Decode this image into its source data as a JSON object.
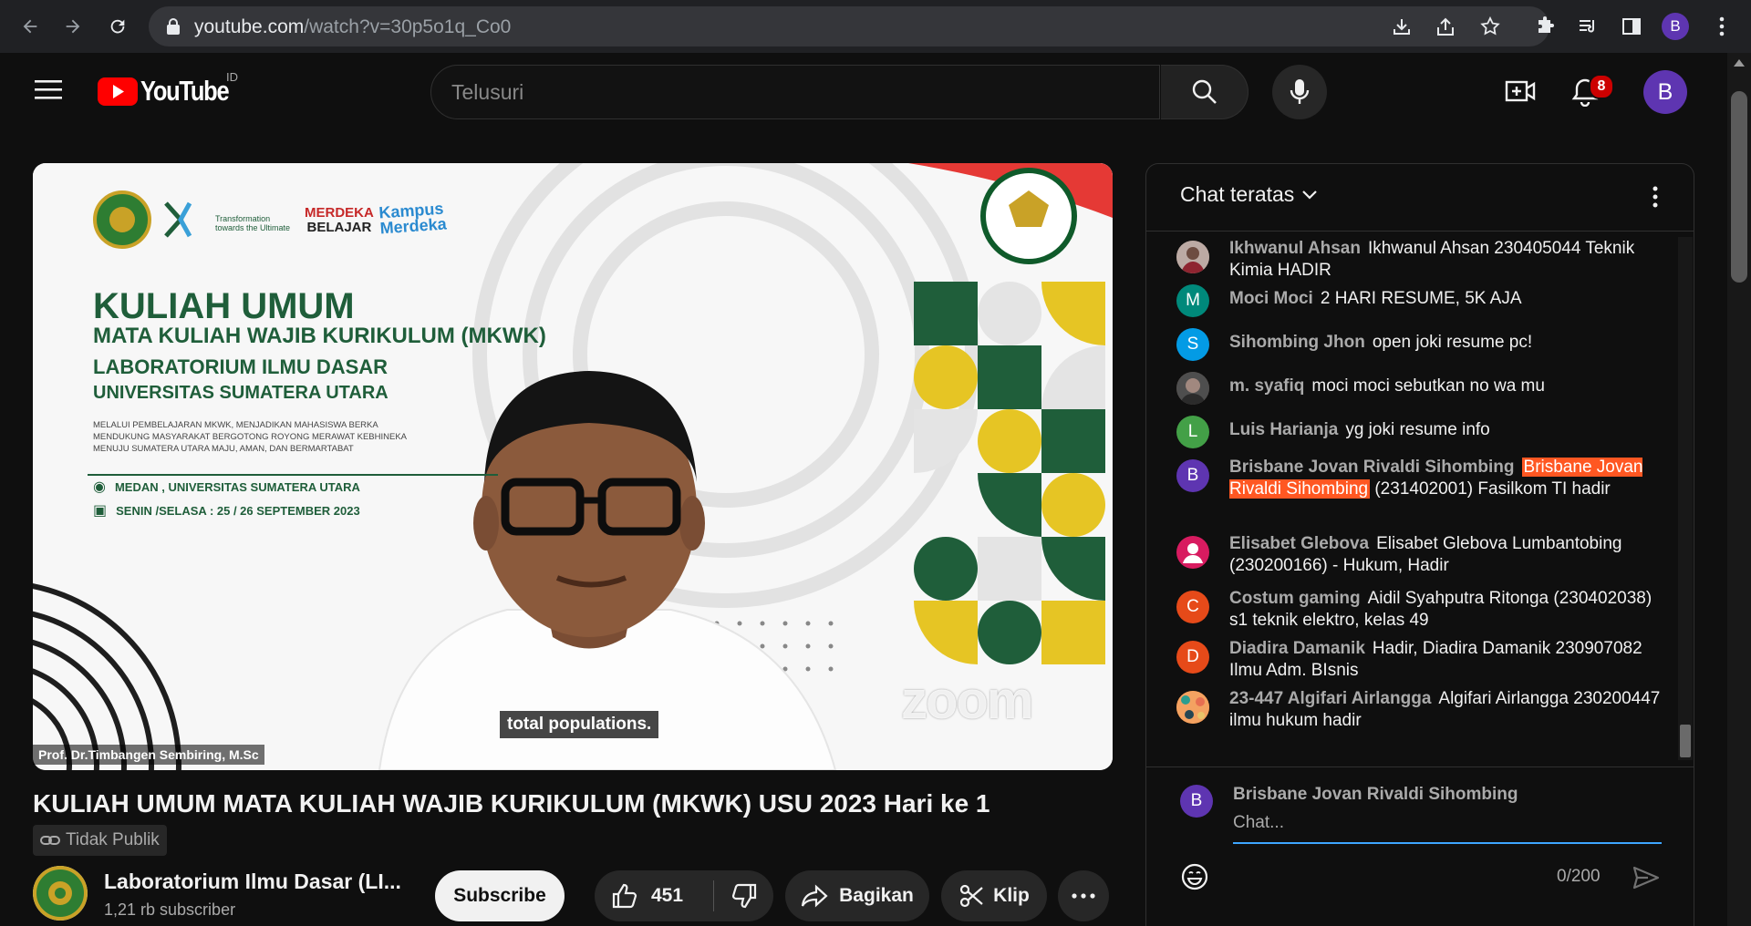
{
  "browser": {
    "url_host": "youtube.com",
    "url_path": "/watch?v=30p5o1q_Co0",
    "profile_initial": "B"
  },
  "header": {
    "logo_text": "YouTube",
    "region": "ID",
    "search_placeholder": "Telusuri",
    "notification_count": "8",
    "avatar_initial": "B"
  },
  "video": {
    "caption": "total populations.",
    "speaker": "Prof. Dr.Timbangen Sembiring, M.Sc",
    "watermark": "zoom",
    "slide": {
      "logo_1_line1": "Transformation",
      "logo_1_line2": "towards the Ultimate",
      "logo_2_line1": "MERDEKA",
      "logo_2_line2": "BELAJAR",
      "logo_3_line1": "Kampus",
      "logo_3_line2": "Merdeka",
      "title": "KULIAH UMUM",
      "subtitle1": "MATA KULIAH WAJIB KURIKULUM (MKWK)",
      "subtitle2": "LABORATORIUM ILMU DASAR",
      "subtitle3": "UNIVERSITAS SUMATERA UTARA",
      "desc1": "MELALUI PEMBELAJARAN MKWK, MENJADIKAN MAHASISWA BERKA",
      "desc2": "MENDUKUNG MASYARAKAT BERGOTONG ROYONG MERAWAT KEBHINEKA",
      "desc3": "MENUJU SUMATERA UTARA MAJU, AMAN, DAN BERMARTABAT",
      "location": "MEDAN , UNIVERSITAS SUMATERA UTARA",
      "date": "SENIN /SELASA : 25 / 26 SEPTEMBER 2023"
    }
  },
  "info": {
    "title": "KULIAH UMUM MATA KULIAH WAJIB KURIKULUM (MKWK) USU 2023 Hari ke 1",
    "visibility": "Tidak Publik",
    "channel_name": "Laboratorium Ilmu Dasar (LI...",
    "subscribers": "1,21 rb subscriber",
    "subscribe_label": "Subscribe",
    "like_count": "451",
    "share_label": "Bagikan",
    "clip_label": "Klip"
  },
  "chat": {
    "title": "Chat teratas",
    "messages": [
      {
        "author": "Ikhwanul Ahsan",
        "text": "Ikhwanul Ahsan 230405044 Teknik Kimia HADIR",
        "initial": "",
        "color": "#8d6e63"
      },
      {
        "author": "Moci Moci",
        "text": "2 HARI RESUME, 5K AJA",
        "initial": "M",
        "color": "#00897b"
      },
      {
        "author": "Sihombing Jhon",
        "text": "open joki resume pc!",
        "initial": "S",
        "color": "#039be5"
      },
      {
        "author": "m. syafiq",
        "text": "moci moci sebutkan no wa mu",
        "initial": "",
        "color": "#5d4037"
      },
      {
        "author": "Luis Harianja",
        "text": "yg joki resume info",
        "initial": "L",
        "color": "#43a047"
      },
      {
        "author": "Brisbane Jovan Rivaldi Sihombing",
        "mention": "Brisbane Jovan Rivaldi Sihombing",
        "text": "(231402001) Fasilkom TI hadir",
        "initial": "B",
        "color": "#5e35b1"
      },
      {
        "author": "Elisabet Glebova",
        "text": "Elisabet Glebova Lumbantobing (230200166) - Hukum, Hadir",
        "initial": "",
        "color": "#d81b60"
      },
      {
        "author": "Costum gaming",
        "text": "Aidil Syahputra Ritonga (230402038) s1 teknik elektro, kelas 49",
        "initial": "C",
        "color": "#e64a19"
      },
      {
        "author": "Diadira Damanik",
        "text": "Hadir, Diadira Damanik 230907082 Ilmu Adm. BIsnis",
        "initial": "D",
        "color": "#e64a19"
      },
      {
        "author": "23-447 Algifari Airlangga",
        "text": "Algifari Airlangga 230200447 ilmu hukum hadir",
        "initial": "",
        "color": "#ef6c00"
      }
    ],
    "me_initial": "B",
    "me_name": "Brisbane Jovan Rivaldi Sihombing",
    "input_placeholder": "Chat...",
    "counter": "0/200"
  }
}
